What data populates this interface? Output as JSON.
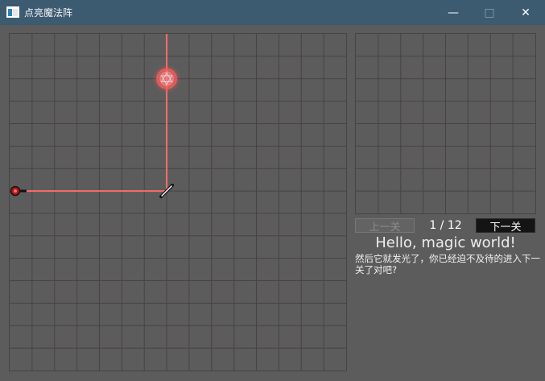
{
  "window": {
    "title": "点亮魔法阵",
    "minimize_glyph": "—",
    "maximize_glyph": "□",
    "close_glyph": "✕"
  },
  "board": {
    "columns": 15,
    "rows": 15,
    "grid_color": "#4a4048",
    "beam_color": "#ff6b6b",
    "emitter": {
      "col": 0,
      "row": 7,
      "direction": "right"
    },
    "mirror": {
      "col": 7,
      "row": 7,
      "orientation": "/"
    },
    "target": {
      "col": 7,
      "row": 2,
      "state": "lit"
    },
    "beam_path": [
      {
        "col": 0,
        "row": 7
      },
      {
        "col": 7,
        "row": 7
      },
      {
        "col": 7,
        "row": -1
      }
    ]
  },
  "side_board": {
    "columns": 8,
    "rows": 8,
    "grid_color": "#4a4048"
  },
  "controls": {
    "prev_label": "上一关",
    "next_label": "下一关",
    "level_counter": "1 / 12"
  },
  "message": {
    "title": "Hello, magic world!",
    "body": "然后它就发光了，你已经迫不及待的进入下一关了对吧?"
  },
  "icons": {
    "app": "app-window-icon",
    "emitter": "laser-emitter-icon",
    "mirror": "mirror-icon",
    "target": "magic-circle-icon"
  }
}
